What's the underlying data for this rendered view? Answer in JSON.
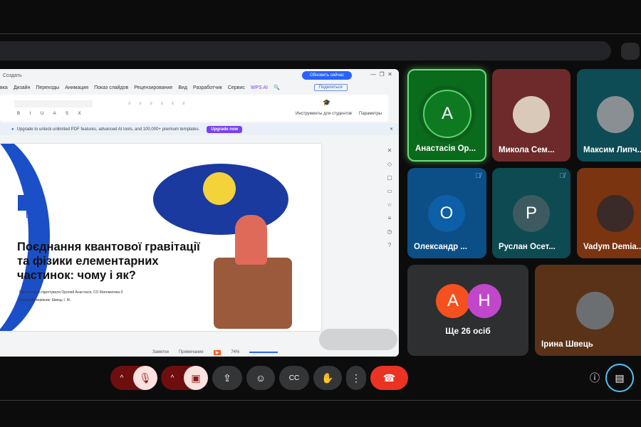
{
  "window": {
    "title": "Создать",
    "update_button": "Обновить сейчас",
    "share_button": "Поделиться"
  },
  "menu": [
    "вка",
    "Дизайн",
    "Переходы",
    "Анимация",
    "Показ слайдов",
    "Рецензирование",
    "Вид",
    "Разработчик",
    "Сервис",
    "WPS AI"
  ],
  "ribbon": {
    "students_tools": "Инструменты для студентов",
    "params": "Параметры"
  },
  "banner": {
    "text": "Upgrade to unlock unlimited PDF features, advanced AI tools, and 100,000+ premium templates.",
    "button": "Upgrade now"
  },
  "slide": {
    "title_lines": [
      "Поєднання квантової гравітації",
      "та фізики елементарних",
      "частинок: чому і як?"
    ],
    "author": "Презентацію підготувала Оропай Анастасія, СО Математика-3",
    "supervisor": "Науковий керівник: Швець І. М."
  },
  "statusbar": {
    "notes": "Заметки",
    "comment": "Примечание",
    "zoom": "74%"
  },
  "participants": [
    {
      "name": "Анастасія Ор...",
      "initial": "А",
      "color": "#0a6b1c"
    },
    {
      "name": "Микола Сем...",
      "color": "#6e2a2a"
    },
    {
      "name": "Максим Липч...",
      "color": "#0d4b55"
    },
    {
      "name": "Олександр ...",
      "initial": "О",
      "color": "#0b4f86",
      "muted": true
    },
    {
      "name": "Руслан Осет...",
      "initial": "Р",
      "color": "#0d4a52",
      "muted": true
    },
    {
      "name": "Vadym Demia...",
      "color": "#7a3410"
    },
    {
      "name": "Ірина Швець",
      "color": "#5a3218"
    }
  ],
  "more": {
    "label": "Ще 26 осіб",
    "initials": [
      "А",
      "Н"
    ],
    "colors": [
      "#f4511e",
      "#c047c9"
    ]
  }
}
